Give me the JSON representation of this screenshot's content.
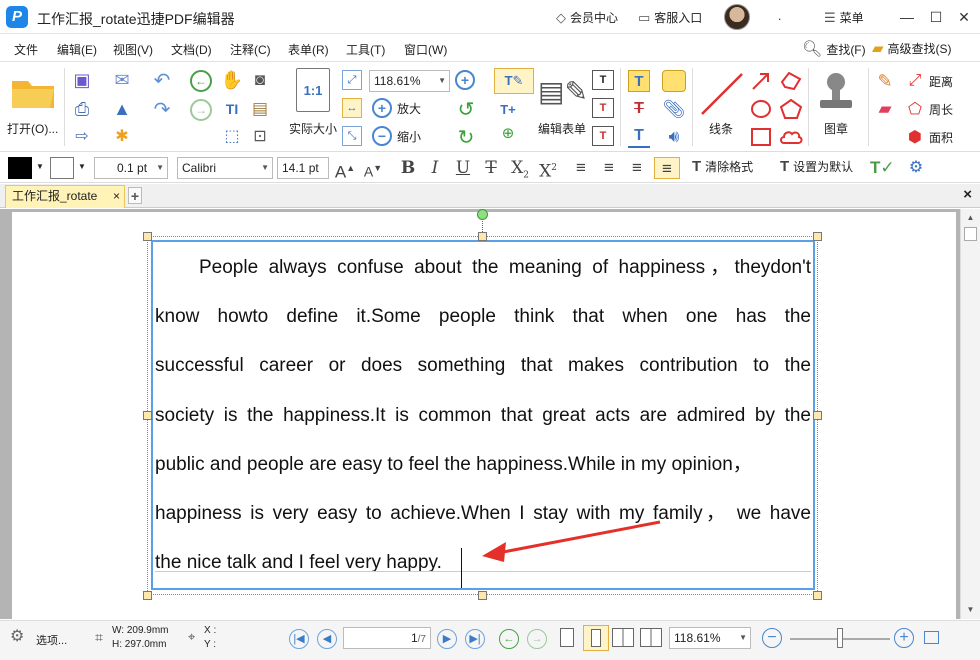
{
  "app": {
    "logo_glyph": "P",
    "title": "工作汇报_rotate迅捷PDF编辑器",
    "member_center": "会员中心",
    "customer_service": "客服入口",
    "dot": ".",
    "menu_label": "菜单"
  },
  "menus": [
    "文件",
    "编辑(E)",
    "视图(V)",
    "文档(D)",
    "注释(C)",
    "表单(R)",
    "工具(T)",
    "窗口(W)"
  ],
  "menu_right": {
    "find": "查找(F)",
    "advanced_find": "高级查找(S)"
  },
  "ribbon": {
    "open_label": "打开(O)...",
    "zoom_value": "118.61%",
    "actual_size_label": "实际大小",
    "actual_size_glyph": "1:1",
    "zoom_in_label": "放大",
    "zoom_out_label": "缩小",
    "edit_form_label": "编辑表单",
    "line_label": "线条",
    "stamp_label": "图章",
    "distance_label": "距离",
    "perimeter_label": "周长",
    "area_label": "面积"
  },
  "format": {
    "stroke_width": "0.1 pt",
    "font_name": "Calibri",
    "font_size": "14.1 pt",
    "clear_format": "清除格式",
    "set_default": "设置为默认"
  },
  "tabs": {
    "doc_tab": "工作汇报_rotate"
  },
  "document": {
    "lines": [
      "People always confuse about the meaning of happiness，theydon't",
      "know howto define it.Some people think that when one has the",
      "successful career or does something that makes contribution to the",
      "society is the happiness.It is common that great acts are admired by the",
      "public and people are easy to feel the happiness.While in my opinion，",
      "happiness is very easy to achieve.When I stay with my family， we have",
      "the nice talk and I feel very happy."
    ]
  },
  "status": {
    "options": "选项...",
    "width": "W: 209.9mm",
    "height": "H: 297.0mm",
    "x": "X :",
    "y": "Y :",
    "page_current": "1",
    "page_total": "/7",
    "zoom": "118.61%"
  },
  "colors": {
    "accent": "#1d86e8",
    "selection": "#5aa0e6",
    "arrow": "#e5302a",
    "tab": "#fff3b8"
  }
}
